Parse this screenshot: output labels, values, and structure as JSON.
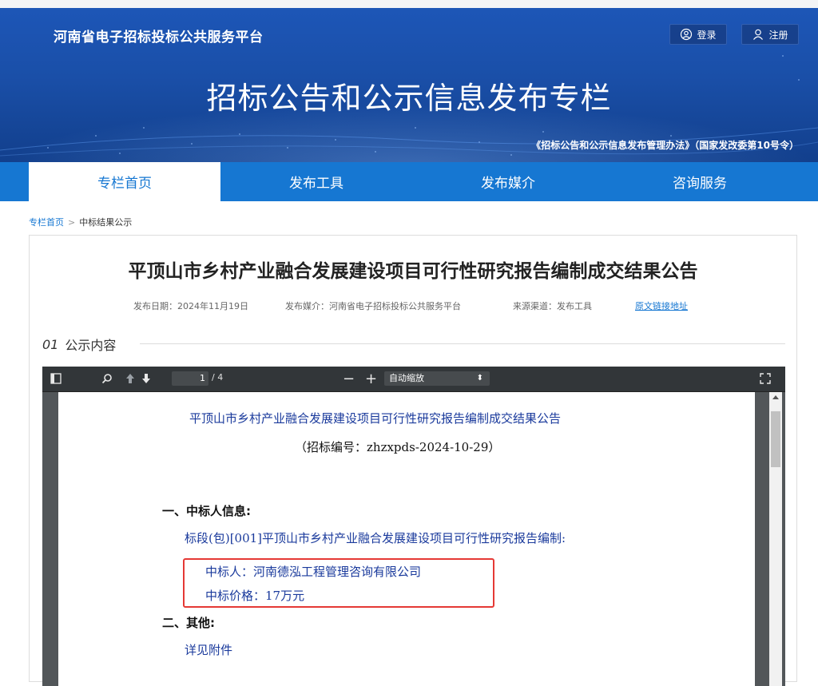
{
  "header": {
    "site_name": "河南省电子招标投标公共服务平台",
    "login_label": "登录",
    "register_label": "注册",
    "banner_title": "招标公告和公示信息发布专栏",
    "law_note": "《招标公告和公示信息发布管理办法》（国家发改委第10号令）"
  },
  "nav": {
    "items": [
      {
        "label": "专栏首页",
        "active": true
      },
      {
        "label": "发布工具",
        "active": false
      },
      {
        "label": "发布媒介",
        "active": false
      },
      {
        "label": "咨询服务",
        "active": false
      }
    ]
  },
  "breadcrumb": {
    "home": "专栏首页",
    "separator": ">",
    "current": "中标结果公示"
  },
  "article": {
    "title": "平顶山市乡村产业融合发展建设项目可行性研究报告编制成交结果公告",
    "publish_date": "发布日期：2024年11月19日",
    "publish_media": "发布媒介：河南省电子招标投标公共服务平台",
    "source_channel": "来源渠道：发布工具",
    "original_link": "原文链接地址",
    "section_number": "01",
    "section_label": "公示内容"
  },
  "pdf_viewer": {
    "page_current": "1",
    "page_total": "/ 4",
    "zoom_label": "自动缩放",
    "content": {
      "title": "平顶山市乡村产业融合发展建设项目可行性研究报告编制成交结果公告",
      "tender_no": "（招标编号：zhzxpds-2024-10-29）",
      "section1_heading": "一、中标人信息:",
      "lot_line": "标段(包)[001]平顶山市乡村产业融合发展建设项目可行性研究报告编制:",
      "winner": "中标人：河南德泓工程管理咨询有限公司",
      "price": "中标价格：17万元",
      "section2_heading": "二、其他:",
      "other_detail": "详见附件"
    }
  },
  "colors": {
    "nav_bg": "#1677d2",
    "banner_bg": "#1a4fa8",
    "highlight_box": "#e53935",
    "pdf_text": "#1a3a9c"
  }
}
